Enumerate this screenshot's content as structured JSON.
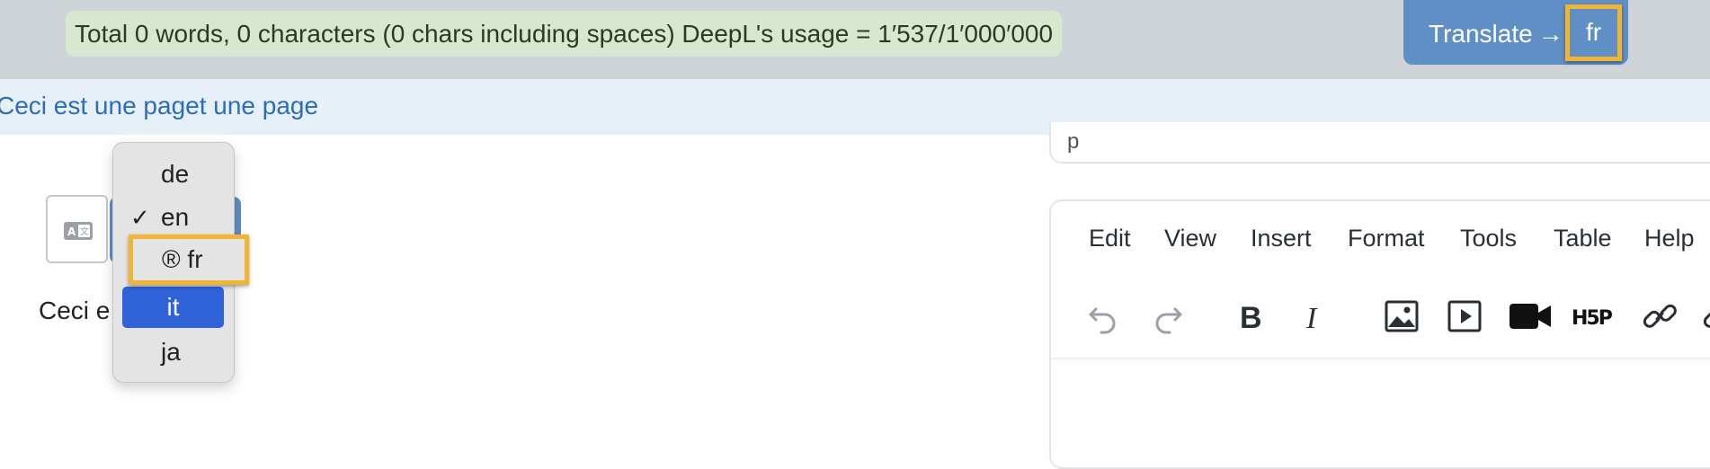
{
  "usage_text": "Total 0 words, 0 characters (0 chars including spaces) DeepL's usage = 1′537/1′000′000",
  "translate": {
    "label": "Translate",
    "arrow": "→",
    "target_lang": "fr"
  },
  "subbar_title": "Ceci est une paget une page",
  "field_top_value": "p",
  "content_text": "Ceci e tenu",
  "dropdown": {
    "options": [
      {
        "code": "de",
        "checked": false,
        "selected": false
      },
      {
        "code": "en",
        "checked": true,
        "selected": false
      },
      {
        "code": "fr",
        "checked": false,
        "selected": false,
        "marker": "®"
      },
      {
        "code": "it",
        "checked": false,
        "selected": true
      },
      {
        "code": "ja",
        "checked": false,
        "selected": false
      }
    ],
    "checkmark": "✓"
  },
  "editor": {
    "menu": [
      "Edit",
      "View",
      "Insert",
      "Format",
      "Tools",
      "Table",
      "Help"
    ],
    "toolbar_icons": [
      "undo-icon",
      "redo-icon",
      "bold-icon",
      "italic-icon",
      "image-icon",
      "media-icon",
      "video-icon",
      "h5p-icon",
      "link-icon",
      "unlink-icon"
    ],
    "bold_glyph": "B",
    "italic_glyph": "I",
    "h5p_glyph": "H5P"
  },
  "colors": {
    "accent": "#5f8fc4",
    "highlight": "#f2b533",
    "selection": "#2f62d9",
    "link": "#2c6cb8"
  }
}
